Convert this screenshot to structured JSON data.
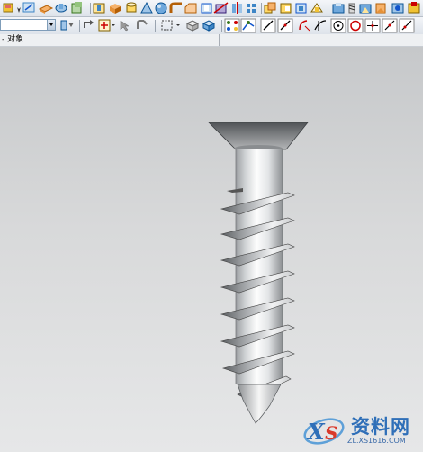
{
  "status_bar": {
    "text": "- 对象"
  },
  "toolbar": {
    "filter_value": "",
    "row1_icons": [
      "new-part-icon",
      "sketch-icon",
      "extrude-icon",
      "revolve-icon",
      "feature-icon",
      "hole-icon",
      "block-icon",
      "cylinder-icon",
      "cone-icon",
      "sphere-icon",
      "edge-blend-icon",
      "chamfer-icon",
      "shell-icon",
      "trim-body-icon",
      "mirror-icon",
      "pattern-icon",
      "unite-icon",
      "subtract-icon",
      "intersect-icon",
      "offset-face-icon",
      "draft-icon",
      "thread-icon",
      "analysis-icon",
      "render-icon"
    ],
    "row2_icons": [
      "filter-settings-icon",
      "undo-snap-icon",
      "snap-point-icon",
      "select-icon",
      "rotate-icon",
      "box-select-icon",
      "view-icon",
      "shaded-view-icon",
      "snap-endpoint-icon",
      "snap-midpoint-icon",
      "line-icon",
      "arc-icon",
      "curve-icon",
      "tangent-icon",
      "center-point-icon",
      "circle-icon",
      "cross-point-icon",
      "line-point-icon",
      "close-snap-icon"
    ]
  },
  "watermark": {
    "brand": "资料网",
    "url": "ZL.XS1616.COM"
  },
  "model": {
    "name": "countersunk-wood-screw",
    "thread_turns": 7
  }
}
